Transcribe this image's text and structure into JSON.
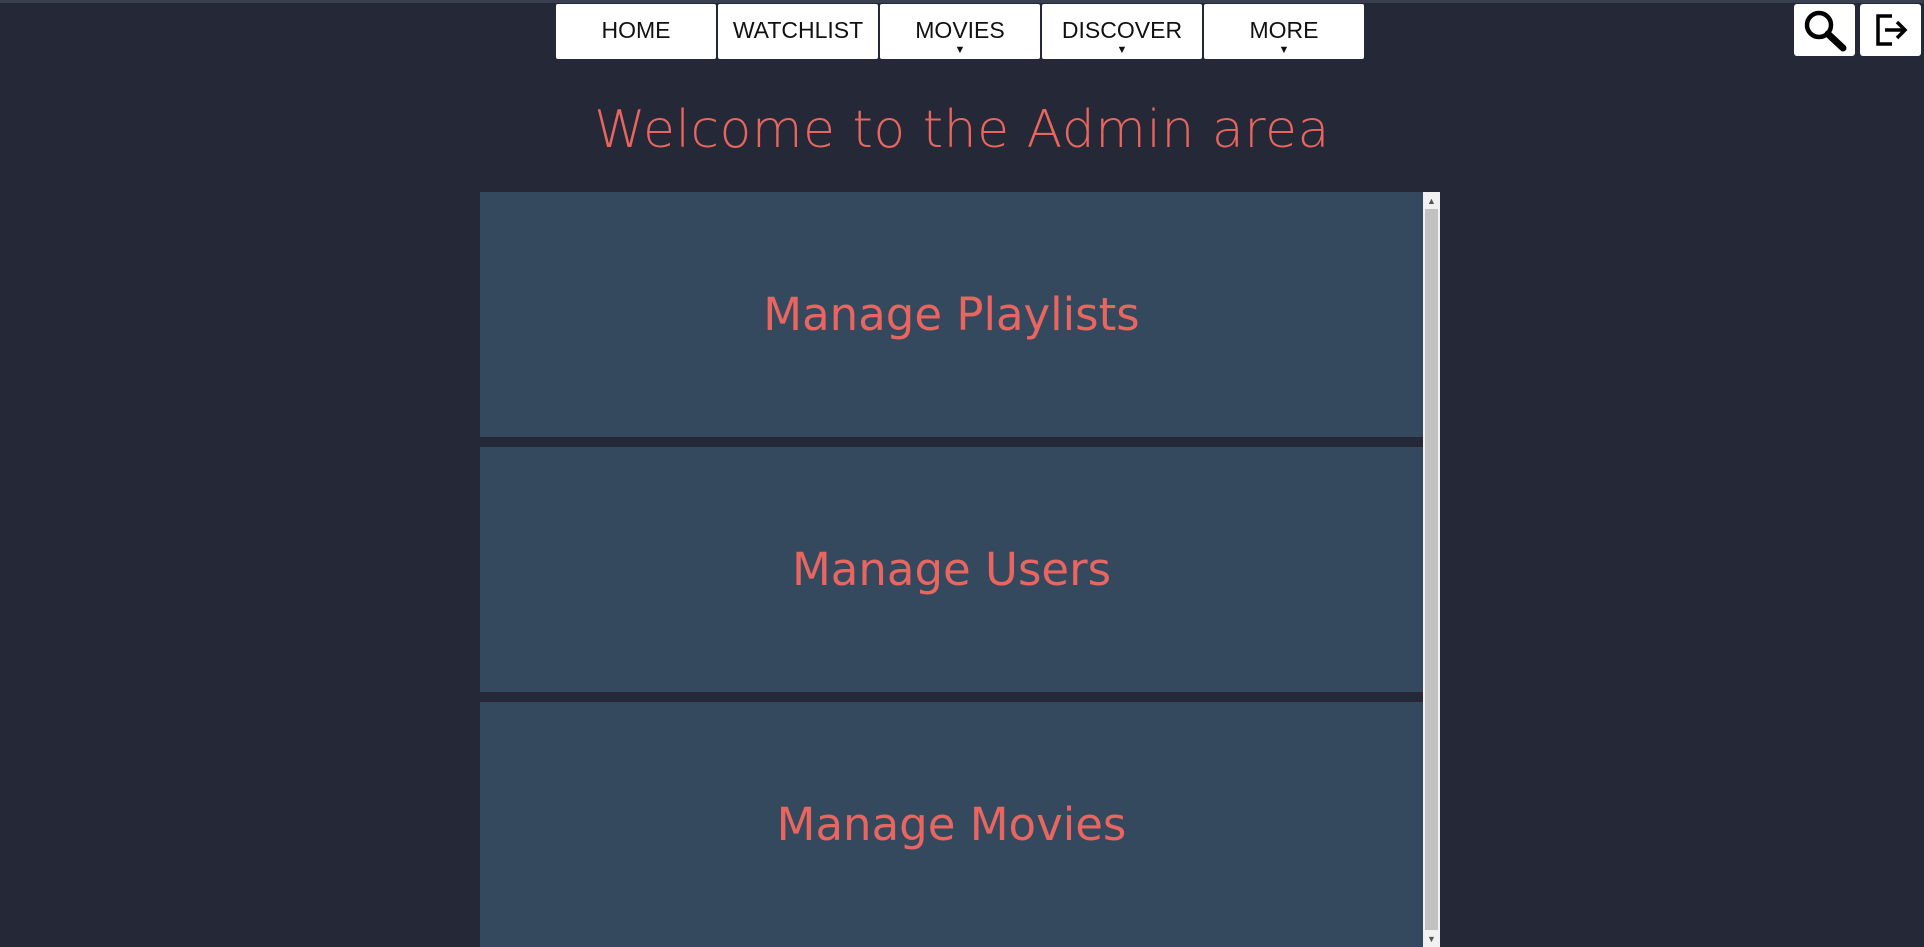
{
  "nav": {
    "items": [
      {
        "label": "HOME",
        "has_dropdown": false
      },
      {
        "label": "WATCHLIST",
        "has_dropdown": false
      },
      {
        "label": "MOVIES",
        "has_dropdown": true
      },
      {
        "label": "DISCOVER",
        "has_dropdown": true
      },
      {
        "label": "MORE",
        "has_dropdown": true
      }
    ],
    "caret": "▼"
  },
  "toolbar": {
    "search_icon": "search-icon",
    "logout_icon": "logout-icon"
  },
  "welcome": {
    "title": "Welcome to the Admin area"
  },
  "admin_cards": [
    {
      "label": "Manage Playlists"
    },
    {
      "label": "Manage Users"
    },
    {
      "label": "Manage Movies"
    }
  ],
  "colors": {
    "background": "#252836",
    "card": "#34495e",
    "accent": "#e8665f",
    "nav_button": "#ffffff"
  }
}
